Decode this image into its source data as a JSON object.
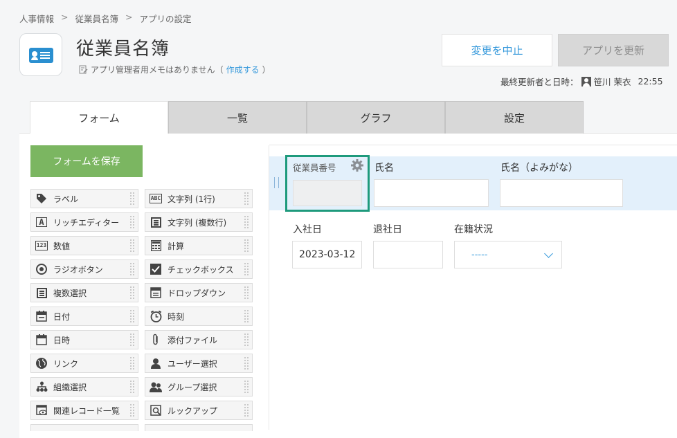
{
  "breadcrumb": [
    "人事情報",
    "従業員名簿",
    "アプリの設定"
  ],
  "breadcrumb_sep": ">",
  "header": {
    "title": "従業員名簿",
    "memo_text": "アプリ管理者用メモはありません（",
    "memo_link": "作成する",
    "memo_close": "）",
    "cancel_label": "変更を中止",
    "update_label": "アプリを更新",
    "updated_label": "最終更新者と日時：",
    "updated_user": "笹川 茉衣",
    "updated_time": "22:55"
  },
  "tabs": [
    "フォーム",
    "一覧",
    "グラフ",
    "設定"
  ],
  "save_form_label": "フォームを保存",
  "palette": [
    {
      "label": "ラベル",
      "icon": "tag-icon"
    },
    {
      "label": "文字列 (1行)",
      "icon": "abc-icon",
      "icon_text": "ABC"
    },
    {
      "label": "リッチエディター",
      "icon": "rich-text-icon",
      "icon_text": "A"
    },
    {
      "label": "文字列 (複数行)",
      "icon": "multiline-icon"
    },
    {
      "label": "数値",
      "icon": "number-icon",
      "icon_text": "123"
    },
    {
      "label": "計算",
      "icon": "calculator-icon"
    },
    {
      "label": "ラジオボタン",
      "icon": "radio-icon"
    },
    {
      "label": "チェックボックス",
      "icon": "checkbox-icon"
    },
    {
      "label": "複数選択",
      "icon": "multi-select-icon"
    },
    {
      "label": "ドロップダウン",
      "icon": "dropdown-icon"
    },
    {
      "label": "日付",
      "icon": "calendar-icon"
    },
    {
      "label": "時刻",
      "icon": "clock-icon"
    },
    {
      "label": "日時",
      "icon": "datetime-icon"
    },
    {
      "label": "添付ファイル",
      "icon": "paperclip-icon"
    },
    {
      "label": "リンク",
      "icon": "globe-icon"
    },
    {
      "label": "ユーザー選択",
      "icon": "user-icon"
    },
    {
      "label": "組織選択",
      "icon": "org-icon"
    },
    {
      "label": "グループ選択",
      "icon": "group-icon"
    },
    {
      "label": "関連レコード一覧",
      "icon": "related-records-icon"
    },
    {
      "label": "ルックアップ",
      "icon": "lookup-icon"
    }
  ],
  "form": {
    "employee_no_label": "従業員番号",
    "name_label": "氏名",
    "name_kana_label": "氏名（よみがな）",
    "join_date_label": "入社日",
    "join_date_value": "2023-03-12",
    "leave_date_label": "退社日",
    "status_label": "在籍状況",
    "status_value": "-----"
  }
}
